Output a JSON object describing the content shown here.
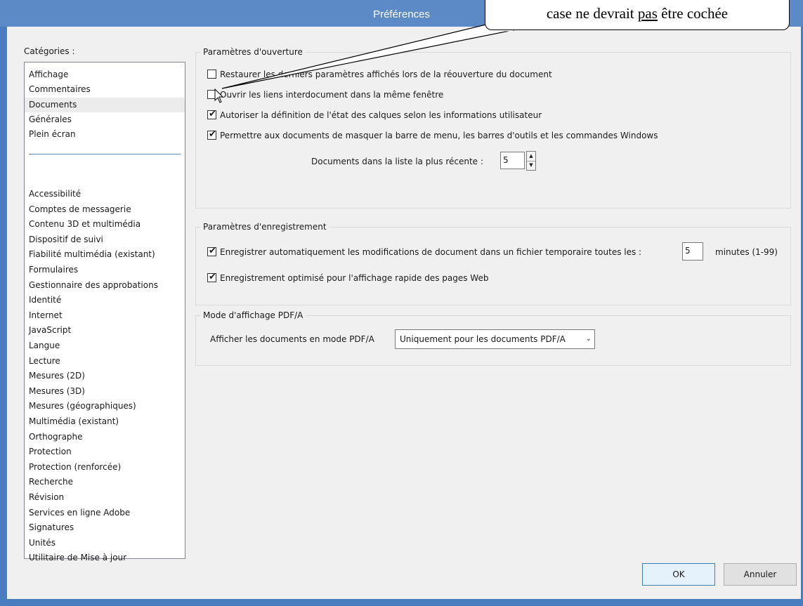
{
  "window": {
    "title": "Préférences"
  },
  "callout": {
    "text_before": "case ne devrait ",
    "text_underlined": "pas",
    "text_after": " être cochée"
  },
  "categories": {
    "label": "Catégories :",
    "group1": [
      "Affichage",
      "Commentaires",
      "Documents",
      "Générales",
      "Plein écran"
    ],
    "group2": [
      "Accessibilité",
      "Comptes de messagerie",
      "Contenu 3D et multimédia",
      "Dispositif de suivi",
      "Fiabilité multimédia (existant)",
      "Formulaires",
      "Gestionnaire des approbations",
      "Identité",
      "Internet",
      "JavaScript",
      "Langue",
      "Lecture",
      "Mesures (2D)",
      "Mesures (3D)",
      "Mesures (géographiques)",
      "Multimédia (existant)",
      "Orthographe",
      "Protection",
      "Protection (renforcée)",
      "Recherche",
      "Révision",
      "Services en ligne Adobe",
      "Signatures",
      "Unités",
      "Utilitaire de Mise à jour"
    ],
    "selected": "Documents"
  },
  "open_settings": {
    "legend": "Paramètres d'ouverture",
    "options": [
      {
        "label": "Restaurer les derniers paramètres affichés lors de la réouverture du document",
        "checked": false
      },
      {
        "label": "Ouvrir les liens interdocument dans la même fenêtre",
        "checked": false
      },
      {
        "label": "Autoriser la définition de l'état des calques selon les informations utilisateur",
        "checked": true
      },
      {
        "label": "Permettre aux documents de masquer la barre de menu, les barres d'outils et les commandes Windows",
        "checked": true
      }
    ],
    "recent_label": "Documents dans la liste la plus récente :",
    "recent_value": "5"
  },
  "save_settings": {
    "legend": "Paramètres d'enregistrement",
    "autosave_label": "Enregistrer automatiquement les modifications de document dans un fichier temporaire toutes les :",
    "autosave_checked": true,
    "autosave_value": "5",
    "autosave_unit": "minutes (1-99)",
    "optimize_label": "Enregistrement optimisé pour l'affichage rapide des pages Web",
    "optimize_checked": true
  },
  "pdfa": {
    "legend": "Mode d'affichage PDF/A",
    "label": "Afficher les documents en mode PDF/A",
    "selected": "Uniquement pour les documents PDF/A"
  },
  "buttons": {
    "ok": "OK",
    "cancel": "Annuler"
  },
  "colors": {
    "titlebar": "#5b8ac6",
    "window_border": "#4a7dbf",
    "panel": "#f0f0f0"
  },
  "icons": {
    "check": "✔",
    "cursor": "arrow-cursor",
    "dropdown": "chevron-down-icon"
  }
}
